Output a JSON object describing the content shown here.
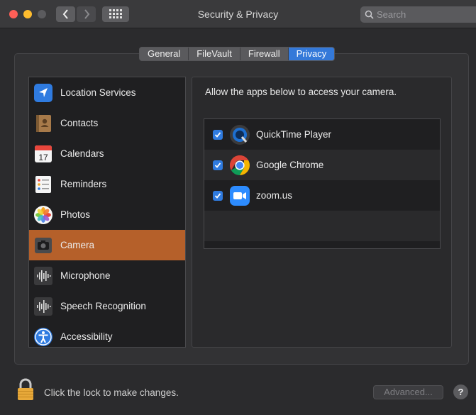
{
  "window": {
    "title": "Security & Privacy",
    "search_placeholder": "Search"
  },
  "tabs": [
    {
      "label": "General",
      "active": false
    },
    {
      "label": "FileVault",
      "active": false
    },
    {
      "label": "Firewall",
      "active": false
    },
    {
      "label": "Privacy",
      "active": true
    }
  ],
  "sidebar": {
    "items": [
      {
        "label": "Location Services",
        "icon": "location-arrow-icon"
      },
      {
        "label": "Contacts",
        "icon": "contacts-book-icon"
      },
      {
        "label": "Calendars",
        "icon": "calendar-icon",
        "icon_text": "17"
      },
      {
        "label": "Reminders",
        "icon": "reminders-list-icon"
      },
      {
        "label": "Photos",
        "icon": "photos-flower-icon"
      },
      {
        "label": "Camera",
        "icon": "camera-icon",
        "selected": true
      },
      {
        "label": "Microphone",
        "icon": "microphone-waveform-icon"
      },
      {
        "label": "Speech Recognition",
        "icon": "speech-waveform-icon"
      },
      {
        "label": "Accessibility",
        "icon": "accessibility-person-icon"
      }
    ]
  },
  "main": {
    "prompt": "Allow the apps below to access your camera.",
    "apps": [
      {
        "name": "QuickTime Player",
        "checked": true,
        "icon": "quicktime-icon"
      },
      {
        "name": "Google Chrome",
        "checked": true,
        "icon": "chrome-icon"
      },
      {
        "name": "zoom.us",
        "checked": true,
        "icon": "zoom-camera-icon"
      }
    ]
  },
  "footer": {
    "lock_text": "Click the lock to make changes.",
    "advanced_label": "Advanced...",
    "help_label": "?"
  },
  "colors": {
    "selection": "#b5602a",
    "accent": "#3479d9",
    "checkbox": "#2f7be0"
  }
}
